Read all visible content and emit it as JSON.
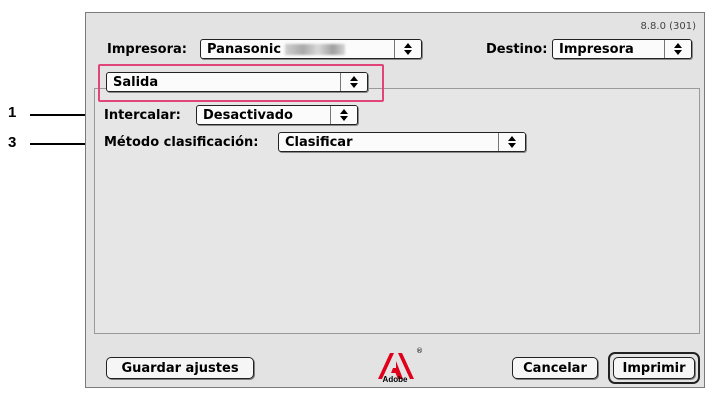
{
  "dialog": {
    "version": "8.8.0 (301)",
    "printer_label": "Impresora:",
    "printer_value": "Panasonic",
    "destination_label": "Destino:",
    "destination_value": "Impresora",
    "section_value": "Salida",
    "collate_label": "Intercalar:",
    "collate_value": "Desactivado",
    "sort_label": "Método clasificación:",
    "sort_value": "Clasificar",
    "save_settings_label": "Guardar ajustes",
    "cancel_label": "Cancelar",
    "print_label": "Imprimir",
    "logo_text": "Adobe",
    "logo_mark": "®"
  },
  "callouts": {
    "collate_number": "1",
    "sort_number": "3"
  },
  "colors": {
    "highlight": "#e0457a",
    "adobe_red": "#e0001b"
  },
  "icons": [
    "updown-arrows-icon",
    "adobe-logo-icon"
  ]
}
